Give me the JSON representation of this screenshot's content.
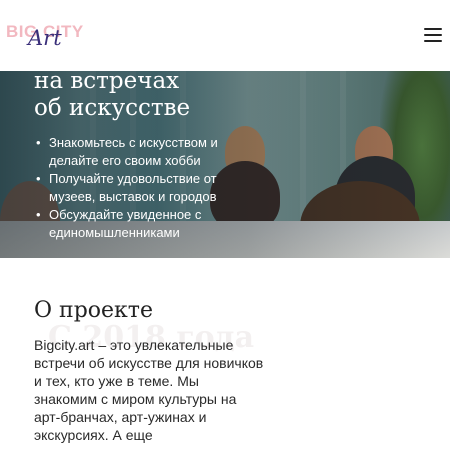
{
  "header": {
    "logo_text": "BIG CITY",
    "logo_art": "Art",
    "menu_icon": "hamburger-icon"
  },
  "hero": {
    "title_line1": "на встречах",
    "title_line2": "об искусстве",
    "bullets": [
      "Знакомьтесь с искусством и делайте его своим хобби",
      "Получайте удовольствие от музеев, выставок и городов",
      "Обсуждайте увиденное с единомышленниками"
    ]
  },
  "about": {
    "title": "О проекте",
    "since": "С 2018 года",
    "text": "Bigcity.art – это увлекательные встречи об искусстве для новичков и тех, кто уже в теме. Мы знакомим с миром культуры на арт-бранчах, арт-ужинах и экскурсиях. А еще"
  }
}
